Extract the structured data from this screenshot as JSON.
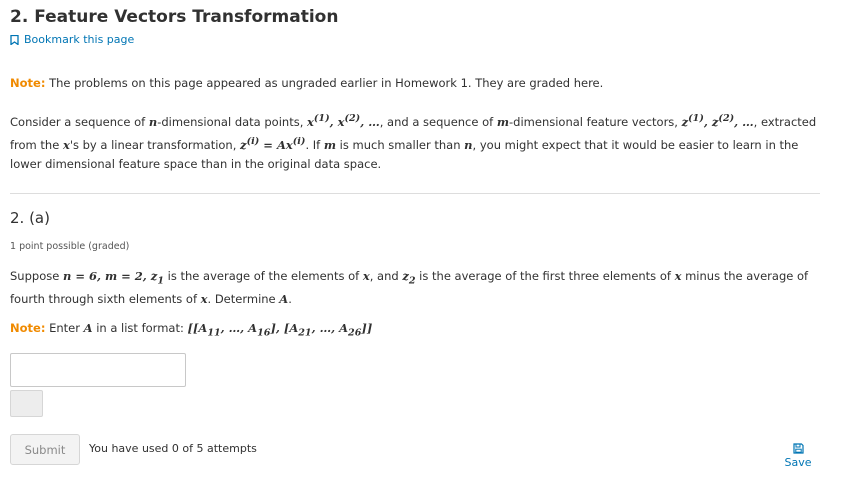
{
  "page": {
    "title": "2. Feature Vectors Transformation",
    "bookmark_label": "Bookmark this page"
  },
  "intro_note": {
    "label": "Note:",
    "text": "The problems on this page appeared as ungraded earlier in Homework 1. They are graded here."
  },
  "description": {
    "t1": "Consider a sequence of ",
    "n": "n",
    "t2": "-dimensional data points, ",
    "x_seq": "x",
    "t3": ", and a sequence of ",
    "m": "m",
    "t4": "-dimensional feature vectors, ",
    "z_seq": "z",
    "t5": ", extracted from the ",
    "x": "x",
    "t6": "'s by a linear transformation, ",
    "t7": ". If ",
    "m2": "m",
    "t8": " is much smaller than ",
    "n2": "n",
    "t9": ", you might expect that it would be easier to learn in the lower dimensional feature space than in the original data space."
  },
  "problem": {
    "title": "2. (a)",
    "points": "1 point possible (graded)",
    "s1": "Suppose ",
    "s2": " is the average of the elements of ",
    "s3": ", and ",
    "s4": " is the average of the first three elements of ",
    "s5": " minus the average of fourth through sixth elements of ",
    "s6": ". Determine ",
    "s7": "."
  },
  "format_note": {
    "label": "Note:",
    "t1": "Enter ",
    "A": "A",
    "t2": " in a list format: "
  },
  "answer_input": {
    "value": "",
    "placeholder": ""
  },
  "actions": {
    "submit_label": "Submit",
    "attempts_text": "You have used 0 of 5 attempts",
    "save_label": "Save"
  },
  "colors": {
    "accent_link": "#0075b4",
    "note_orange": "#f08a00",
    "text": "#313131"
  },
  "icons": {
    "bookmark": "bookmark-icon",
    "save": "floppy-disk-icon"
  }
}
